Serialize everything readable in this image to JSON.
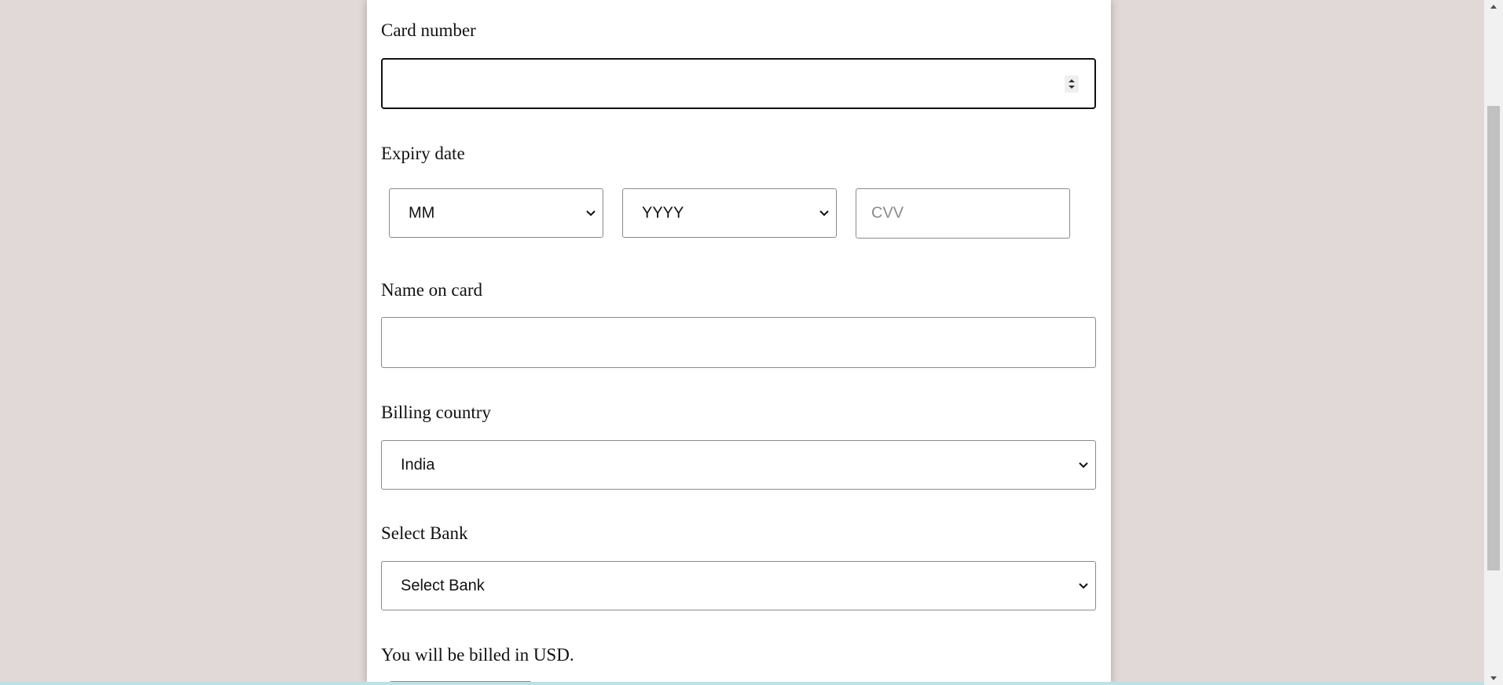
{
  "form": {
    "card_number": {
      "label": "Card number",
      "value": ""
    },
    "expiry": {
      "label": "Expiry date",
      "month": "MM",
      "year": "YYYY",
      "cvv_placeholder": "CVV"
    },
    "name_on_card": {
      "label": "Name on card",
      "value": ""
    },
    "billing_country": {
      "label": "Billing country",
      "selected": "India"
    },
    "bank": {
      "label": "Select Bank",
      "selected": "Select Bank"
    },
    "billing_note": "You will be billed in USD."
  },
  "colors": {
    "background": "#e1d8d8",
    "panel": "#ffffff",
    "border": "#8a8a8a",
    "focus_border": "#111111"
  },
  "icons": {
    "dropdown": "chevron-down-icon",
    "spinner": "number-spinner-icon",
    "scroll_up": "scroll-up-arrow-icon",
    "scroll_down": "scroll-down-arrow-icon"
  }
}
